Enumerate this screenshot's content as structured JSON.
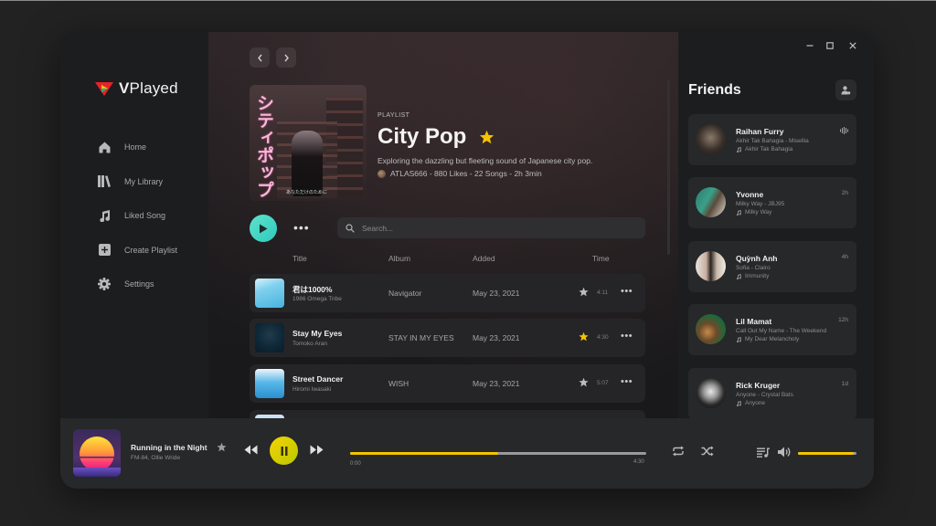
{
  "app": {
    "brand": "VPlayed",
    "brand_prefix": "V",
    "brand_suffix": "Played"
  },
  "sidebar": {
    "items": [
      {
        "label": "Home",
        "icon": "home-icon"
      },
      {
        "label": "My Library",
        "icon": "library-icon"
      },
      {
        "label": "Liked Song",
        "icon": "music-note-icon"
      },
      {
        "label": "Create Playlist",
        "icon": "plus-square-icon"
      },
      {
        "label": "Settings",
        "icon": "gear-icon"
      }
    ]
  },
  "playlist": {
    "type_label": "PLAYLIST",
    "title": "City Pop",
    "favorited": true,
    "description": "Exploring the dazzling but fleeting sound of Japanese city pop.",
    "meta": "ATLAS666 - 880 Likes - 22 Songs - 2h 3min",
    "cover_text": "シティポップ",
    "cover_subtext": "あなただけのために"
  },
  "search": {
    "placeholder": "Search..."
  },
  "columns": {
    "title": "Title",
    "album": "Album",
    "added": "Added",
    "time": "Time"
  },
  "tracks": [
    {
      "title": "君は1000%",
      "artist": "1986 Omega Tribe",
      "album": "Navigator",
      "added": "May 23, 2021",
      "time": "4:11",
      "favorited": false
    },
    {
      "title": "Stay My Eyes",
      "artist": "Tomoko Aran",
      "album": "STAY IN MY EYES",
      "added": "May 23, 2021",
      "time": "4:30",
      "favorited": true
    },
    {
      "title": "Street Dancer",
      "artist": "Hiromi Iwasaki",
      "album": "WISH",
      "added": "May 23, 2021",
      "time": "5:07",
      "favorited": false
    }
  ],
  "friends": {
    "title": "Friends",
    "list": [
      {
        "name": "Raihan Furry",
        "song": "Akhir Tak Bahagia - Misellia",
        "context": "Akhir Tak Bahagia",
        "status": "listening"
      },
      {
        "name": "Yvonne",
        "song": "Milky Way - JBJ95",
        "context": "Milky Way",
        "status": "2h"
      },
      {
        "name": "Quỳnh Anh",
        "song": "Sofia - Clairo",
        "context": "Immunity",
        "status": "4h"
      },
      {
        "name": "Lil Mamat",
        "song": "Call Out My Name - The Weekend",
        "context": "My Dear Melancholy",
        "status": "12h"
      },
      {
        "name": "Rick Kruger",
        "song": "Anyone - Crystal Bats",
        "context": "Anyone",
        "status": "1d"
      }
    ]
  },
  "player": {
    "title": "Running in the Night",
    "artist": "FM-84, Ollie Wride",
    "current_time": "0:00",
    "total_time": "4:30",
    "progress_percent": 50,
    "volume_percent": 95,
    "state": "playing"
  },
  "colors": {
    "accent_yellow": "#f5c400",
    "accent_teal": "#3fd6c4",
    "star_active": "#f5c400",
    "star_inactive": "#bdbdbd"
  }
}
